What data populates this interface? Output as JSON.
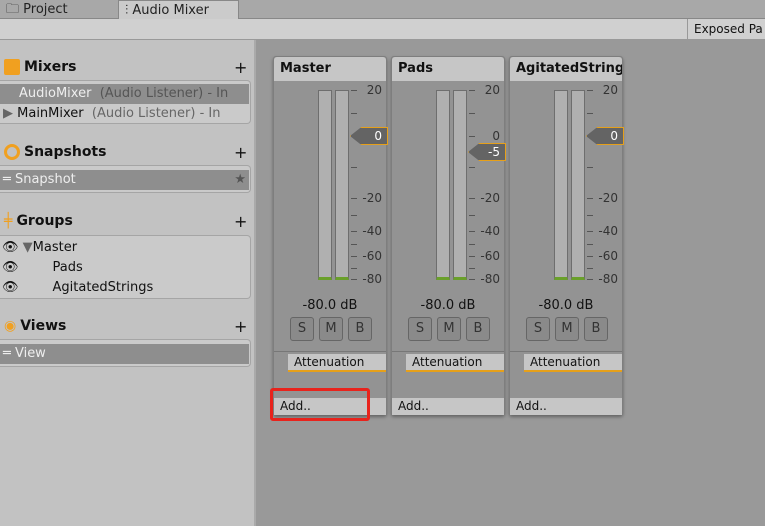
{
  "tabs": [
    {
      "label": "Project",
      "icon": "folder-icon"
    },
    {
      "label": "Audio Mixer",
      "icon": "mixer-sliders-icon",
      "active": true
    }
  ],
  "toolbar": {
    "exposed_params": "Exposed Pa"
  },
  "mixers": {
    "title": "Mixers",
    "add": "+",
    "items": [
      {
        "name": "AudioMixer",
        "detail": "(Audio Listener) - In",
        "selected": true
      },
      {
        "name": "MainMixer",
        "detail": "(Audio Listener) - In",
        "collapsed": true
      }
    ]
  },
  "snapshots": {
    "title": "Snapshots",
    "add": "+",
    "items": [
      {
        "name": "Snapshot",
        "starred": true
      }
    ]
  },
  "groups": {
    "title": "Groups",
    "add": "+",
    "items": [
      {
        "name": "Master"
      },
      {
        "name": "Pads"
      },
      {
        "name": "AgitatedStrings"
      }
    ]
  },
  "views": {
    "title": "Views",
    "add": "+",
    "items": [
      {
        "name": "View"
      }
    ]
  },
  "scale": [
    "20",
    "0",
    "-20",
    "-40",
    "-60",
    "-80"
  ],
  "strips": [
    {
      "name": "Master",
      "fader": "0",
      "fader_db": 0,
      "level": "-80.0 dB",
      "buttons": [
        "S",
        "M",
        "B"
      ],
      "effect": "Attenuation",
      "add": "Add.."
    },
    {
      "name": "Pads",
      "fader": "-5",
      "fader_db": -5,
      "level": "-80.0 dB",
      "buttons": [
        "S",
        "M",
        "B"
      ],
      "effect": "Attenuation",
      "add": "Add.."
    },
    {
      "name": "AgitatedStrings",
      "fader": "0",
      "fader_db": 0,
      "level": "-80.0 dB",
      "buttons": [
        "S",
        "M",
        "B"
      ],
      "effect": "Attenuation",
      "add": "Add.."
    }
  ],
  "colors": {
    "accent": "#e6a01a",
    "meter_green": "#6aa02a",
    "highlight": "#e8231c"
  }
}
